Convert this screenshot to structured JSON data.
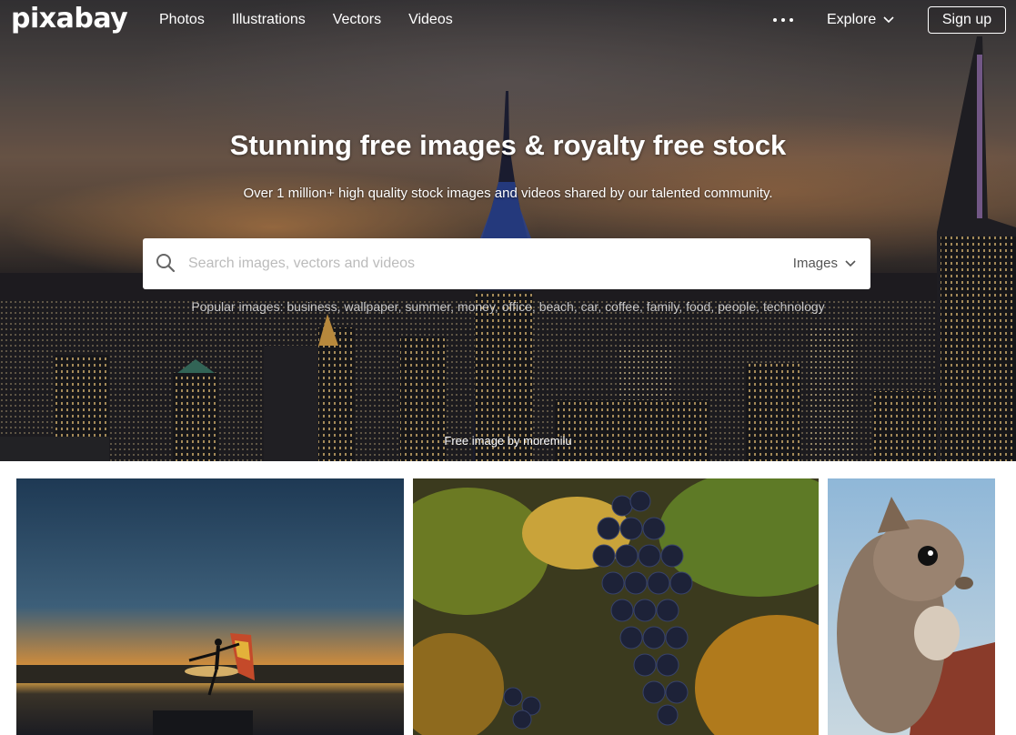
{
  "nav": {
    "logo": "pixabay",
    "links": [
      "Photos",
      "Illustrations",
      "Vectors",
      "Videos"
    ],
    "explore": "Explore",
    "signup": "Sign up"
  },
  "hero": {
    "title": "Stunning free images & royalty free stock",
    "subtitle": "Over 1 million+ high quality stock images and videos shared by our talented community.",
    "search_placeholder": "Search images, vectors and videos",
    "search_type": "Images",
    "popular_prefix": "Popular images:",
    "popular_tags": [
      "business",
      "wallpaper",
      "summer",
      "money",
      "office",
      "beach",
      "car",
      "coffee",
      "family",
      "food",
      "people",
      "technology"
    ],
    "credit_prefix": "Free image by",
    "credit_author": "moremilu"
  },
  "icons": {
    "more": "more-dots-icon",
    "explore_chevron": "chevron-down-icon",
    "search": "search-icon",
    "type_chevron": "chevron-down-icon"
  },
  "colors": {
    "accent_white": "#ffffff",
    "search_bg": "#ffffff",
    "placeholder": "#bbbbbb"
  }
}
